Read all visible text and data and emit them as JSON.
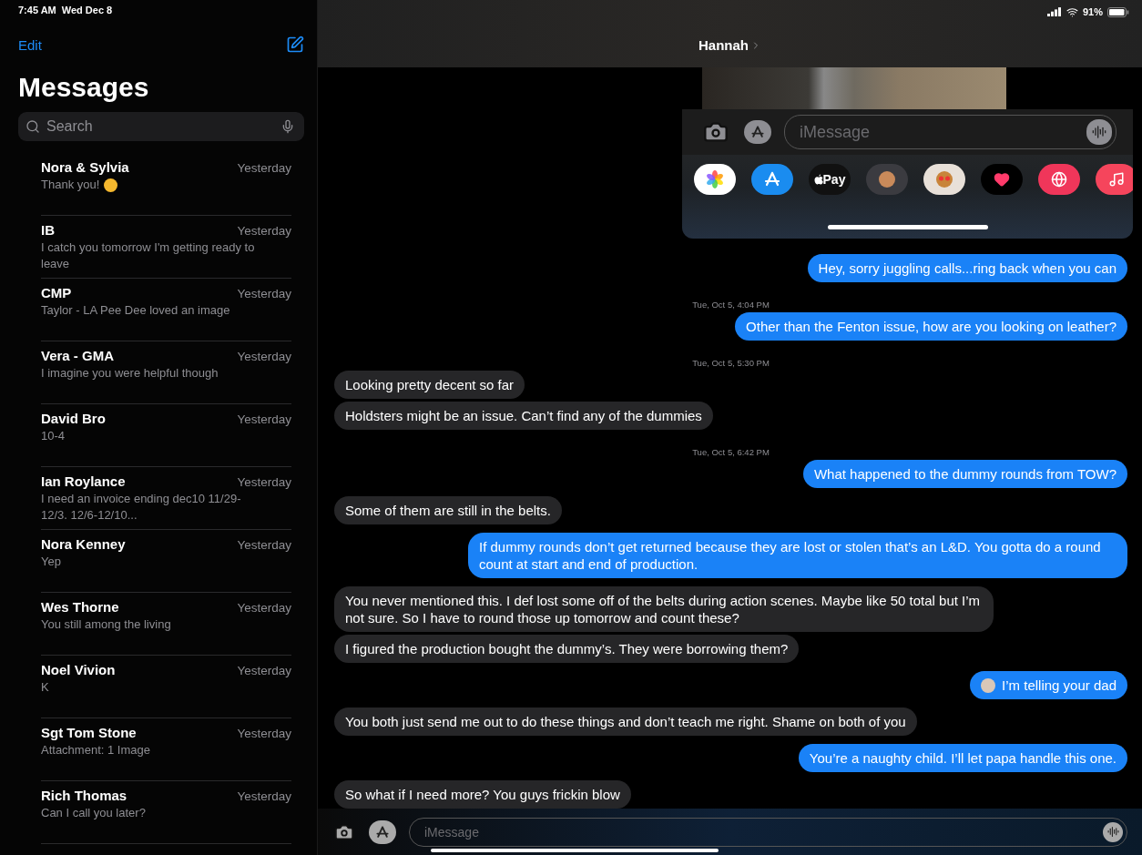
{
  "status_bar": {
    "time": "7:45 AM",
    "date": "Wed Dec 8",
    "battery": "91%"
  },
  "sidebar": {
    "edit": "Edit",
    "title": "Messages",
    "search": {
      "placeholder": "Search"
    },
    "conversations": [
      {
        "name": "Nora & Sylvia",
        "time": "Yesterday",
        "preview": "Thank you!",
        "emoji": true
      },
      {
        "name": "IB",
        "time": "Yesterday",
        "preview": "I catch you tomorrow I'm getting ready to leave"
      },
      {
        "name": "CMP",
        "time": "Yesterday",
        "preview": "Taylor - LA Pee Dee loved an image"
      },
      {
        "name": "Vera - GMA",
        "time": "Yesterday",
        "preview": "I imagine you were helpful though"
      },
      {
        "name": "David Bro",
        "time": "Yesterday",
        "preview": "10-4"
      },
      {
        "name": "Ian Roylance",
        "time": "Yesterday",
        "preview": "I need an invoice ending dec10 11/29-12/3. 12/6-12/10..."
      },
      {
        "name": "Nora Kenney",
        "time": "Yesterday",
        "preview": "Yep"
      },
      {
        "name": "Wes Thorne",
        "time": "Yesterday",
        "preview": "You still among the living"
      },
      {
        "name": "Noel Vivion",
        "time": "Yesterday",
        "preview": "K"
      },
      {
        "name": "Sgt Tom Stone",
        "time": "Yesterday",
        "preview": "Attachment: 1 Image"
      },
      {
        "name": "Rich Thomas",
        "time": "Yesterday",
        "preview": "Can I call you later?"
      }
    ]
  },
  "chat": {
    "contact": "Hannah",
    "drawer": {
      "placeholder": "iMessage",
      "apps": [
        {
          "kind": "photos"
        },
        {
          "kind": "store"
        },
        {
          "kind": "pay",
          "label": "Pay"
        },
        {
          "kind": "memoji"
        },
        {
          "kind": "stickers"
        },
        {
          "kind": "heart"
        },
        {
          "kind": "search"
        },
        {
          "kind": "music"
        }
      ]
    },
    "messages": [
      {
        "kind": "out",
        "text": "Hey, sorry juggling calls...ring back when you can"
      },
      {
        "kind": "timestamp",
        "text": "Tue, Oct 5, 4:04 PM"
      },
      {
        "kind": "out",
        "text": "Other than the Fenton issue, how are you looking on leather?"
      },
      {
        "kind": "timestamp",
        "text": "Tue, Oct 5, 5:30 PM"
      },
      {
        "kind": "in",
        "text": "Looking pretty decent so far"
      },
      {
        "kind": "in",
        "text": "Holdsters might be an issue. Can’t find any of the dummies"
      },
      {
        "kind": "timestamp",
        "text": "Tue, Oct 5, 6:42 PM"
      },
      {
        "kind": "out",
        "text": "What happened to the dummy rounds from TOW?"
      },
      {
        "kind": "in",
        "text": "Some of them are still in the belts."
      },
      {
        "kind": "out",
        "text": "If dummy rounds don’t get returned because they are lost or stolen that’s an L&D. You gotta do a round count at start and end of production."
      },
      {
        "kind": "in",
        "text": "You never mentioned this. I def lost some off of the belts during action scenes. Maybe like 50 total but I’m not sure. So I have to round those up tomorrow and count these?"
      },
      {
        "kind": "in",
        "text": "I figured the production bought the dummy’s. They were borrowing them?"
      },
      {
        "kind": "out",
        "text": "I’m telling your dad",
        "avatar": true
      },
      {
        "kind": "in",
        "text": "You both just send me out to do these things and don’t teach me right. Shame on both of you"
      },
      {
        "kind": "out",
        "text": "You’re a naughty child. I’ll let papa handle this one."
      },
      {
        "kind": "in",
        "text": "So what if I need more? You guys frickin blow"
      }
    ]
  },
  "composer": {
    "placeholder": "iMessage"
  }
}
